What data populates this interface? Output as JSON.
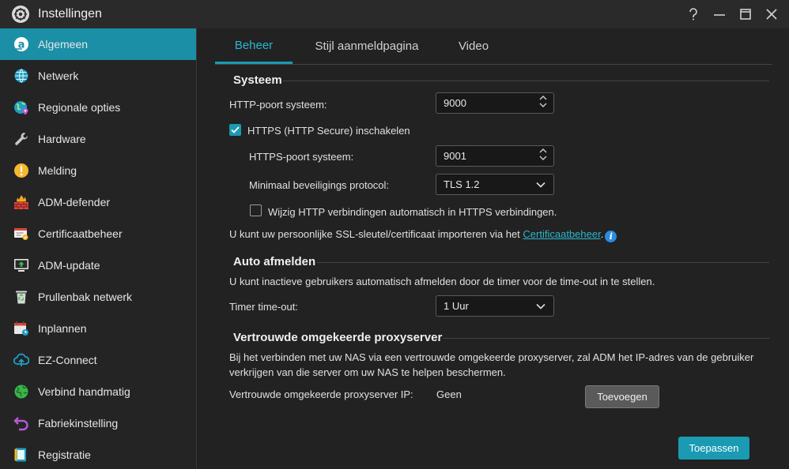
{
  "window": {
    "title": "Instellingen",
    "icon": "gear-icon"
  },
  "sidebar": {
    "items": [
      {
        "label": "Algemeen",
        "icon": "general-icon",
        "active": true
      },
      {
        "label": "Netwerk",
        "icon": "globe-icon"
      },
      {
        "label": "Regionale opties",
        "icon": "region-globe-icon"
      },
      {
        "label": "Hardware",
        "icon": "wrench-icon"
      },
      {
        "label": "Melding",
        "icon": "alert-icon"
      },
      {
        "label": "ADM-defender",
        "icon": "firewall-icon"
      },
      {
        "label": "Certificaatbeheer",
        "icon": "certificate-icon"
      },
      {
        "label": "ADM-update",
        "icon": "update-icon"
      },
      {
        "label": "Prullenbak netwerk",
        "icon": "recycle-bin-icon"
      },
      {
        "label": "Inplannen",
        "icon": "calendar-icon"
      },
      {
        "label": "EZ-Connect",
        "icon": "cloud-upload-icon"
      },
      {
        "label": "Verbind handmatig",
        "icon": "connect-globe-icon"
      },
      {
        "label": "Fabriekinstelling",
        "icon": "undo-icon"
      },
      {
        "label": "Registratie",
        "icon": "registration-icon"
      }
    ]
  },
  "tabs": [
    {
      "label": "Beheer",
      "active": true
    },
    {
      "label": "Stijl aanmeldpagina"
    },
    {
      "label": "Video"
    }
  ],
  "systeem": {
    "title": "Systeem",
    "http_port_label": "HTTP-poort systeem:",
    "http_port_value": "9000",
    "https_enable_label": "HTTPS (HTTP Secure) inschakelen",
    "https_enable_checked": true,
    "https_port_label": "HTTPS-poort systeem:",
    "https_port_value": "9001",
    "min_protocol_label": "Minimaal beveiligings protocol:",
    "min_protocol_value": "TLS 1.2",
    "redirect_label": "Wijzig HTTP verbindingen automatisch in HTTPS verbindingen.",
    "redirect_checked": false,
    "ssl_text": "U kunt uw persoonlijke SSL-sleutel/certificaat importeren via het ",
    "ssl_link": "Certificaatbeheer",
    "ssl_after": "."
  },
  "auto_logout": {
    "title": "Auto afmelden",
    "description": "U kunt inactieve gebruikers automatisch afmelden door de timer voor de time-out in te stellen.",
    "timeout_label": "Timer time-out:",
    "timeout_value": "1 Uur"
  },
  "proxy": {
    "title": "Vertrouwde omgekeerde proxyserver",
    "description_line1": "Bij het verbinden met uw NAS via een vertrouwde omgekeerde proxyserver, zal ADM het IP-adres van de gebruiker",
    "description_line2": "verkrijgen van die server om uw NAS te helpen beschermen.",
    "ip_label": "Vertrouwde omgekeerde proxyserver IP:",
    "ip_value": "Geen",
    "add_button": "Toevoegen"
  },
  "footer": {
    "apply_button": "Toepassen"
  },
  "colors": {
    "accent": "#1a9ab3",
    "active_nav": "#1a8fa6",
    "link": "#2ab7d1"
  }
}
